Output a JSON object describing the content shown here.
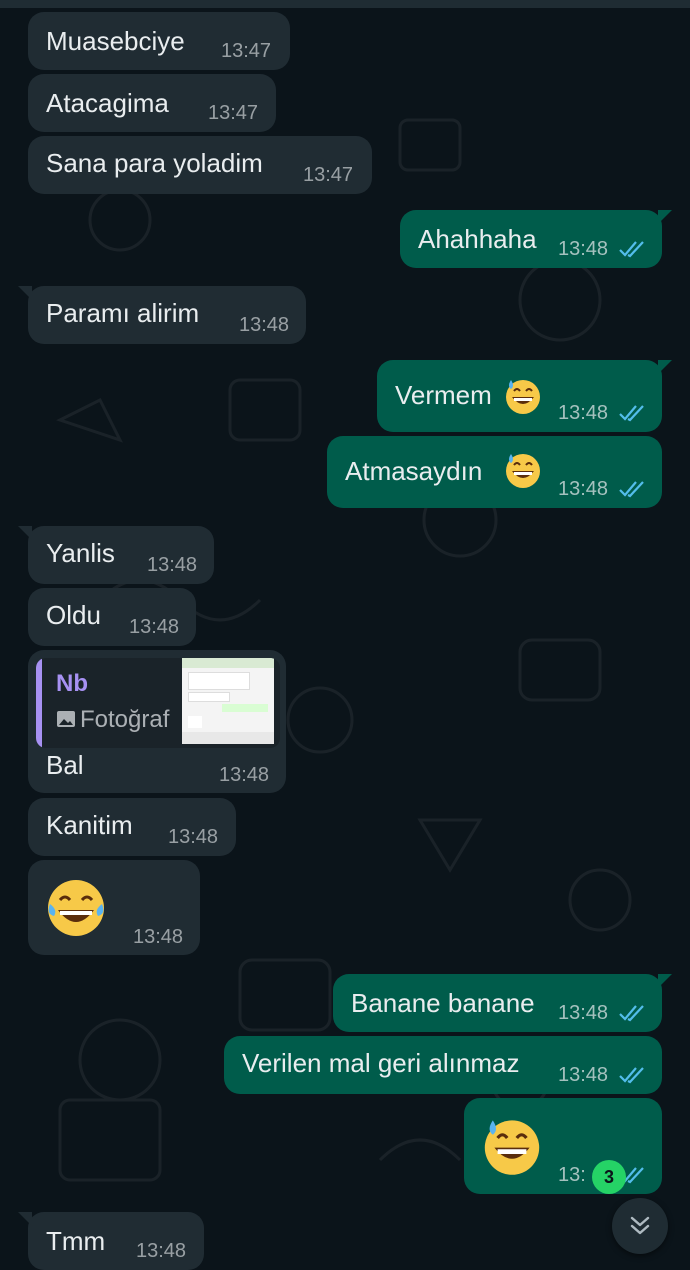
{
  "messages": [
    {
      "dir": "in",
      "text": "Muasebciye",
      "time": "13:47"
    },
    {
      "dir": "in",
      "text": "Atacagima",
      "time": "13:47"
    },
    {
      "dir": "in",
      "text": "Sana para yoladim",
      "time": "13:47"
    },
    {
      "dir": "out",
      "text": "Ahahhaha",
      "time": "13:48",
      "status": "read"
    },
    {
      "dir": "in",
      "text": "Paramı alirim",
      "time": "13:48"
    },
    {
      "dir": "out",
      "text": "Vermem",
      "emoji": "grinning-sweat",
      "time": "13:48",
      "status": "read"
    },
    {
      "dir": "out",
      "text": "Atmasaydın",
      "emoji": "grinning-sweat",
      "time": "13:48",
      "status": "read"
    },
    {
      "dir": "in",
      "text": "Yanlis",
      "time": "13:48"
    },
    {
      "dir": "in",
      "text": "Oldu",
      "time": "13:48"
    },
    {
      "dir": "in",
      "text": "Bal",
      "time": "13:48",
      "reply": {
        "sender": "Nb",
        "type": "Fotoğraf"
      }
    },
    {
      "dir": "in",
      "text": "Kanitim",
      "time": "13:48"
    },
    {
      "dir": "in",
      "emoji": "tears-of-joy",
      "time": "13:48"
    },
    {
      "dir": "out",
      "text": "Banane banane",
      "time": "13:48",
      "status": "read"
    },
    {
      "dir": "out",
      "text": "Verilen mal geri alınmaz",
      "time": "13:48",
      "status": "read"
    },
    {
      "dir": "out",
      "emoji": "grinning-sweat",
      "time": "13:",
      "status": "read"
    },
    {
      "dir": "in",
      "text": "Tmm",
      "time": "13:48"
    }
  ],
  "unread_count": "3",
  "colors": {
    "background": "#0b141a",
    "incoming": "#202c33",
    "outgoing": "#005c4b",
    "read_ticks": "#53bdeb",
    "reply_accent": "#a791f2",
    "badge": "#25d366"
  },
  "icons": {
    "read_receipt": "double-check-icon",
    "reply_photo": "image-icon",
    "scroll_down": "double-chevron-down-icon"
  }
}
